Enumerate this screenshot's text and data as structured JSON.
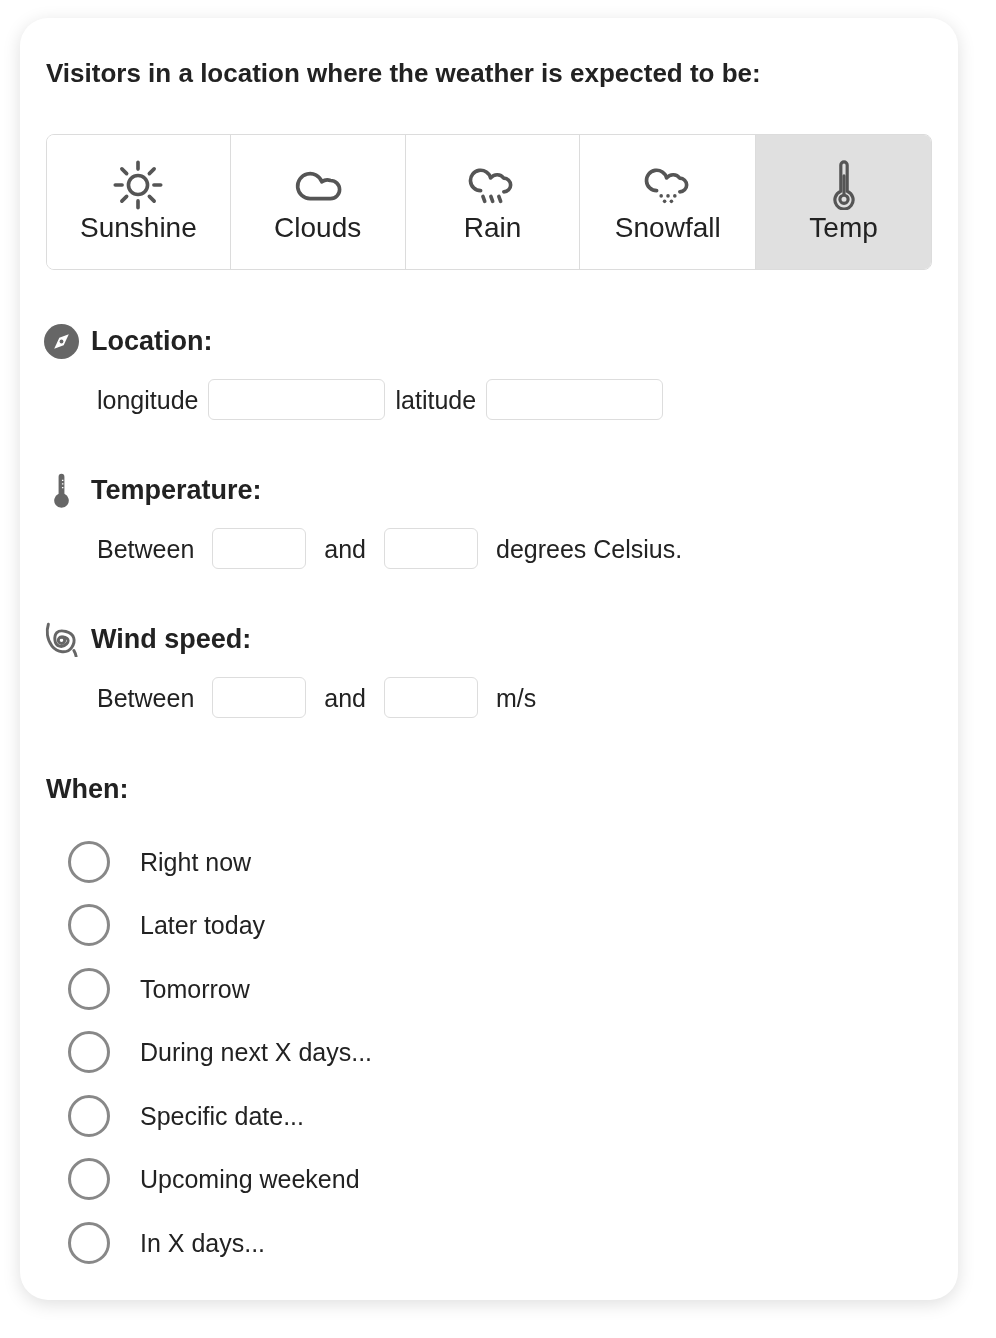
{
  "heading": "Visitors in a location where the weather is expected to be:",
  "tabs": [
    {
      "kind": "sun",
      "label": "Sunshine",
      "selected": false
    },
    {
      "kind": "cloud",
      "label": "Clouds",
      "selected": false
    },
    {
      "kind": "rain",
      "label": "Rain",
      "selected": false
    },
    {
      "kind": "snow",
      "label": "Snowfall",
      "selected": false
    },
    {
      "kind": "thermometer",
      "label": "Temp",
      "selected": true
    }
  ],
  "sections": [
    {
      "kind": "location",
      "title": "Location:",
      "row": [
        {
          "kind": "label",
          "text": "longitude"
        },
        {
          "kind": "field"
        },
        {
          "kind": "label",
          "text": "latitude"
        },
        {
          "kind": "field"
        }
      ]
    },
    {
      "kind": "temperature",
      "title": "Temperature:",
      "row": [
        {
          "kind": "label",
          "text": "Between"
        },
        {
          "kind": "field"
        },
        {
          "kind": "label",
          "text": "and"
        },
        {
          "kind": "field"
        },
        {
          "kind": "label",
          "text": "degrees Celsius."
        }
      ]
    },
    {
      "kind": "wind",
      "title": "Wind speed:",
      "row": [
        {
          "kind": "label",
          "text": "Between"
        },
        {
          "kind": "field"
        },
        {
          "kind": "label",
          "text": "and"
        },
        {
          "kind": "field"
        },
        {
          "kind": "label",
          "text": "m/s"
        }
      ]
    }
  ],
  "when": {
    "title": "When:",
    "options": [
      {
        "label": "Right now",
        "selected": false
      },
      {
        "label": "Later today",
        "selected": false
      },
      {
        "label": "Tomorrow",
        "selected": false
      },
      {
        "label": "During next X days...",
        "selected": false
      },
      {
        "label": "Specific date...",
        "selected": false
      },
      {
        "label": "Upcoming weekend",
        "selected": false
      },
      {
        "label": "In X days...",
        "selected": false
      }
    ]
  }
}
